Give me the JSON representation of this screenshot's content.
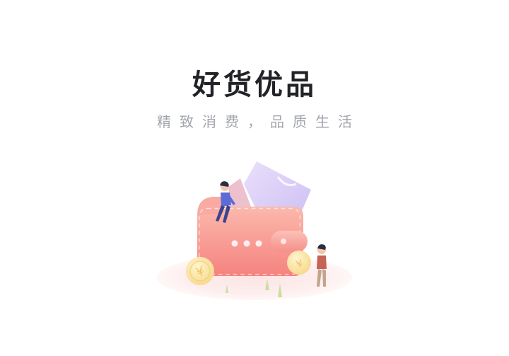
{
  "splash": {
    "title": "好货优品",
    "subtitle": "精致消费，品质生活"
  },
  "illustration": {
    "icon": "wallet-with-coins-and-people-illustration",
    "coin_symbol": "¥"
  },
  "colors": {
    "background": "#ffffff",
    "title": "#222326",
    "subtitle": "#a3a6ad",
    "wallet": "#f59a95",
    "coin": "#fbe7a6"
  }
}
